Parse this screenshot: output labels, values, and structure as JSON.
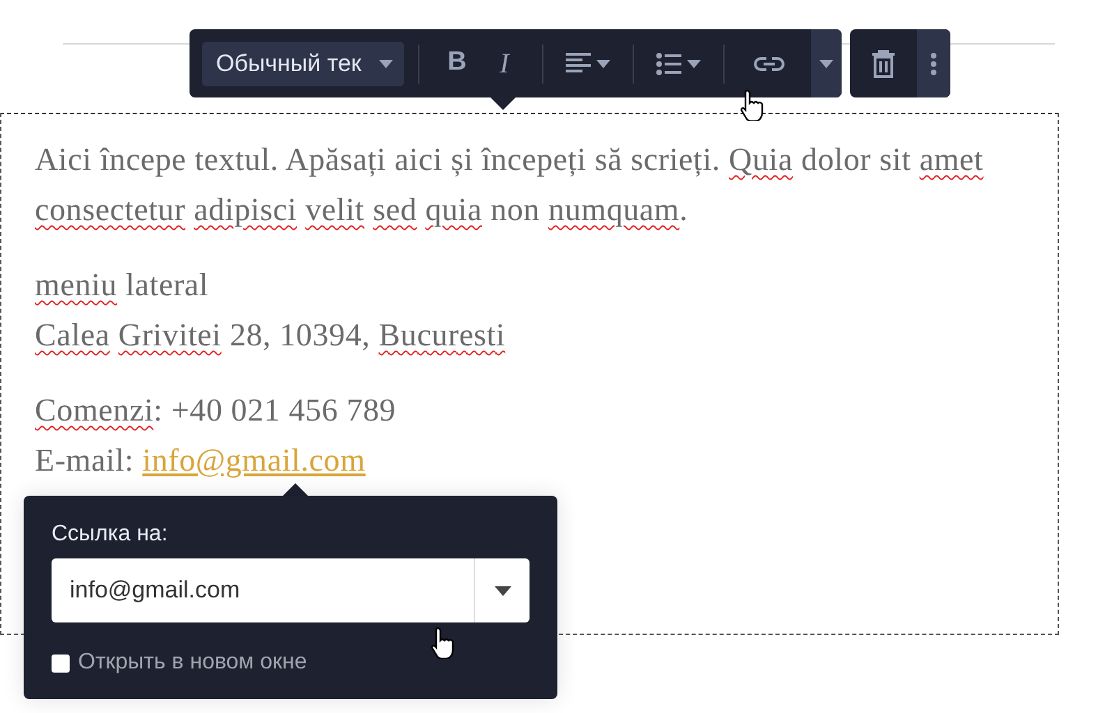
{
  "toolbar": {
    "format_dropdown": "Обычный тек",
    "buttons": [
      {
        "kind": "bold",
        "label": "B"
      },
      {
        "kind": "italic",
        "label": "I"
      },
      {
        "kind": "align"
      },
      {
        "kind": "list"
      },
      {
        "kind": "link"
      },
      {
        "kind": "more-caret"
      }
    ],
    "actions": [
      {
        "kind": "delete"
      },
      {
        "kind": "kebab"
      }
    ]
  },
  "editor": {
    "blocks": [
      {
        "lines": [
          [
            {
              "text": "Aici începe textul. Apăsați aici și începeți să scrieți. "
            },
            {
              "text": "Quia ",
              "misspelled": true
            },
            {
              "text": "dolor sit "
            },
            {
              "text": "amet ",
              "misspelled": true
            },
            {
              "text": "consectetur ",
              "misspelled": true
            },
            {
              "text": "adipisci ",
              "misspelled": true
            },
            {
              "text": "velit ",
              "misspelled": true
            },
            {
              "text": "sed ",
              "misspelled": true
            },
            {
              "text": "quia ",
              "misspelled": true
            },
            {
              "text": "non "
            },
            {
              "text": "numquam",
              "misspelled": true
            },
            {
              "text": "."
            }
          ]
        ]
      },
      {
        "lines": [
          [
            {
              "text": "meniu ",
              "misspelled": true
            },
            {
              "text": "lateral"
            }
          ],
          [
            {
              "text": "Calea ",
              "misspelled": true
            },
            {
              "text": "Grivitei ",
              "misspelled": true
            },
            {
              "text": "28, 10394, "
            },
            {
              "text": "Bucuresti",
              "misspelled": true
            }
          ]
        ]
      },
      {
        "lines": [
          [
            {
              "text": "Comenzi",
              "misspelled": true
            },
            {
              "text": ": +40 021 456 789"
            }
          ],
          [
            {
              "text": "E-mail: "
            },
            {
              "text": "info@gmail.com",
              "link": true
            }
          ]
        ]
      }
    ]
  },
  "link_popup": {
    "label": "Ссылка на:",
    "value": "info@gmail.com",
    "new_window": {
      "label": "Открыть в новом окне",
      "checked": false
    }
  }
}
